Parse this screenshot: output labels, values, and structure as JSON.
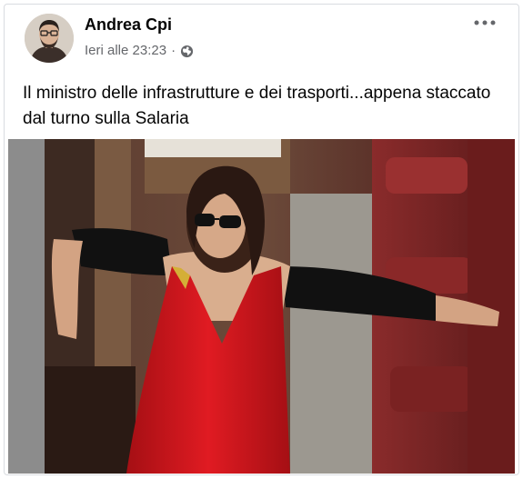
{
  "post": {
    "author_name": "Andrea Cpi",
    "timestamp": "Ieri alle 23:23",
    "separator": "·",
    "audience_icon": "globe-icon",
    "more_icon": "more-options-icon",
    "text": "Il ministro delle infrastrutture e dei trasporti...appena staccato dal turno sulla Salaria"
  },
  "colors": {
    "author": "#050505",
    "meta": "#65676b",
    "dress": "#c8141a",
    "seats": "#6e2323"
  }
}
